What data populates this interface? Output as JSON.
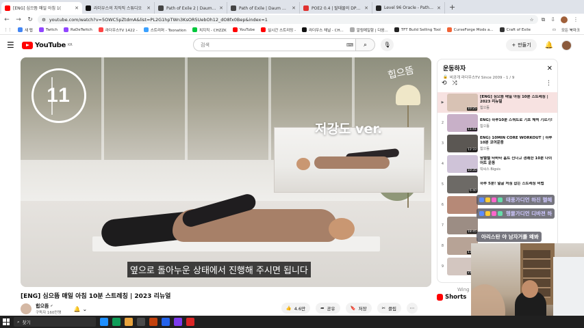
{
  "browser": {
    "tabs": [
      {
        "label": "[ENG] 심으뜸 매일 아침 1(",
        "color": "#ff0000",
        "active": true
      },
      {
        "label": "라더우스의 치직직 스튜디오",
        "color": "#111111"
      },
      {
        "label": "Path of Exile 2 | Daum 게임",
        "color": "#444444"
      },
      {
        "label": "Path of Exile | Daum 게임",
        "color": "#444444"
      },
      {
        "label": "POE2 0.4 | 탈태물의 DPS 22(",
        "color": "#e0312f"
      },
      {
        "label": "Level 96 Oracle - Path of Ex",
        "color": "#222222"
      }
    ],
    "new_tab": "+",
    "url": "youtube.com/watch?v=5OWC5pZtdmA&list=PL2G1hpTWn3KsOR5UebOh12_dO8fx0Bep&index=1",
    "bookmarks": [
      {
        "label": "새 탭",
        "color": "#4285f4"
      },
      {
        "label": "Twitch",
        "color": "#9146ff"
      },
      {
        "label": "RaDeTwitch",
        "color": "#9146ff"
      },
      {
        "label": "라더우스TV 1422 -",
        "color": "#ff4444"
      },
      {
        "label": "스트리머 - Toonation",
        "color": "#3ba1ff"
      },
      {
        "label": "치지직 - CHZZK",
        "color": "#00c73c"
      },
      {
        "label": "YouTube",
        "color": "#ff0000"
      },
      {
        "label": "실시간 스트리밍 -",
        "color": "#ff0000"
      },
      {
        "label": "라더우스 채널 - CH...",
        "color": "#111111"
      },
      {
        "label": "알림메일함 | 다음...",
        "color": "#aaaaaa"
      },
      {
        "label": "TFT Build Selling Tool",
        "color": "#222222"
      },
      {
        "label": "CurseForge Mods a...",
        "color": "#f16436"
      },
      {
        "label": "Craft of Exile",
        "color": "#333333"
      }
    ],
    "all_bookmarks": "모든 북마크"
  },
  "youtube": {
    "logo_text": "YouTube",
    "logo_region": "KR",
    "search_placeholder": "검색",
    "create_label": "만들기",
    "video": {
      "title": "[ENG] 심으뜸 매일 아침 10분 스트레칭 | 2023 리뉴얼",
      "count_overlay": "11",
      "brand_sign": "힙으뜸",
      "inset_label": "저강도 ver.",
      "subtitle": "옆으로 돌아누운 상태에서 진행해 주시면 됩니다"
    },
    "channel": {
      "name": "힙으뜸",
      "subscribers": "구독자 160만명"
    },
    "actions": [
      {
        "icon": "like-icon",
        "glyph": "👍",
        "label": "4.6만"
      },
      {
        "icon": "share-icon",
        "glyph": "➦",
        "label": "공유"
      },
      {
        "icon": "save-icon",
        "glyph": "🔖",
        "label": "저장"
      },
      {
        "icon": "clip-icon",
        "glyph": "✂",
        "label": "클립"
      }
    ],
    "playlist": {
      "title": "운동하자",
      "subtitle": "비공개 라더우스TV Since 2009 - 1 / 9",
      "items": [
        {
          "index": "▶",
          "title": "[ENG] 심으뜸 매일 아침 10분 스트레칭 | 2023 리뉴얼",
          "channel": "힙으뜸",
          "duration": "10:25",
          "thumb": "#d8c2b4"
        },
        {
          "index": "2",
          "title": "ENG) 하루10분 스쿼트로 기초 체력 기르기!",
          "channel": "힙으뜸",
          "duration": "11:41",
          "thumb": "#c8b0c8"
        },
        {
          "index": "3",
          "title": "ENG) 10MIN CORE WORKOUT | 하루10분 코어운동",
          "channel": "힙으뜸",
          "duration": "12:33",
          "thumb": "#5b5753"
        },
        {
          "index": "4",
          "title": "땀뻘뻘 타바타 홈트 신나고 경쾌한 10분 다이어트 운동",
          "channel": "빅씨스 Bigsis",
          "duration": "10:35",
          "thumb": "#cfc3d8"
        },
        {
          "index": "5",
          "title": "하루 5분! 얼굴 처짐 잡는 스트레칭 비법",
          "channel": "",
          "duration": "6:40",
          "thumb": "#6d6a66"
        },
        {
          "index": "6",
          "title": "",
          "channel": "",
          "duration": "",
          "thumb": "#b68977"
        },
        {
          "index": "7",
          "title": "",
          "channel": "",
          "duration": "18:45",
          "thumb": "#9c8d84"
        },
        {
          "index": "8",
          "title": "",
          "channel": "",
          "duration": "13:20",
          "thumb": "#b7a396"
        },
        {
          "index": "9",
          "title": "",
          "channel": "",
          "duration": "21:23",
          "thumb": "#d3c6c0"
        }
      ]
    },
    "shorts_label": "Shorts",
    "side_ghost": "Wing"
  },
  "chat": [
    {
      "text": "태풍가디언 하진 헬해",
      "color": "#cfc8ff"
    },
    {
      "text": "헹뮬가디언 디바젼 하",
      "color": "#cfc8ff"
    },
    {
      "text": "아리스탄 야 남자거를 왜봐",
      "color": "#ffffff"
    }
  ],
  "taskbar": {
    "search_label": "찾기",
    "apps": [
      "#1e90ff",
      "#0f9d58",
      "#e8a33d",
      "#4a4a4a",
      "#c2410c",
      "#2563eb",
      "#7c3aed",
      "#dc2626"
    ]
  }
}
